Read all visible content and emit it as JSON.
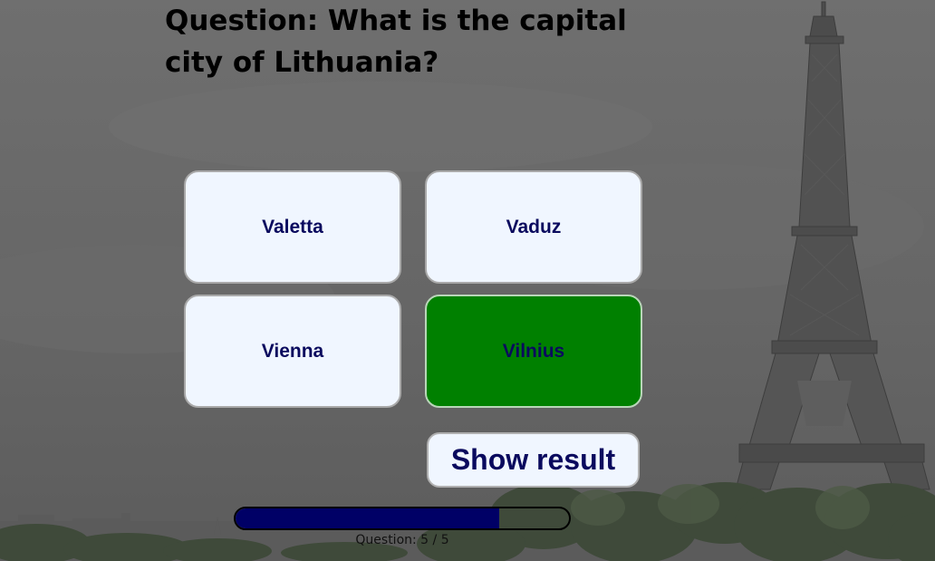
{
  "quiz": {
    "question": "Question: What is the capital city of Lithuania?",
    "answers": [
      {
        "label": "Valetta",
        "state": "default"
      },
      {
        "label": "Vaduz",
        "state": "default"
      },
      {
        "label": "Vienna",
        "state": "default"
      },
      {
        "label": "Vilnius",
        "state": "correct"
      }
    ],
    "show_result_label": "Show result"
  },
  "progress": {
    "label": "Question: 5 / 5",
    "current": 5,
    "total": 5,
    "bar_fill_fraction": 0.79
  },
  "colors": {
    "answer_bg": "#f0f6ff",
    "answer_text": "#0a0a5e",
    "correct_bg": "#008000",
    "progress_fill": "#000066",
    "backdrop": "#666666"
  },
  "background": {
    "scene": "eiffel-tower-cityscape"
  }
}
